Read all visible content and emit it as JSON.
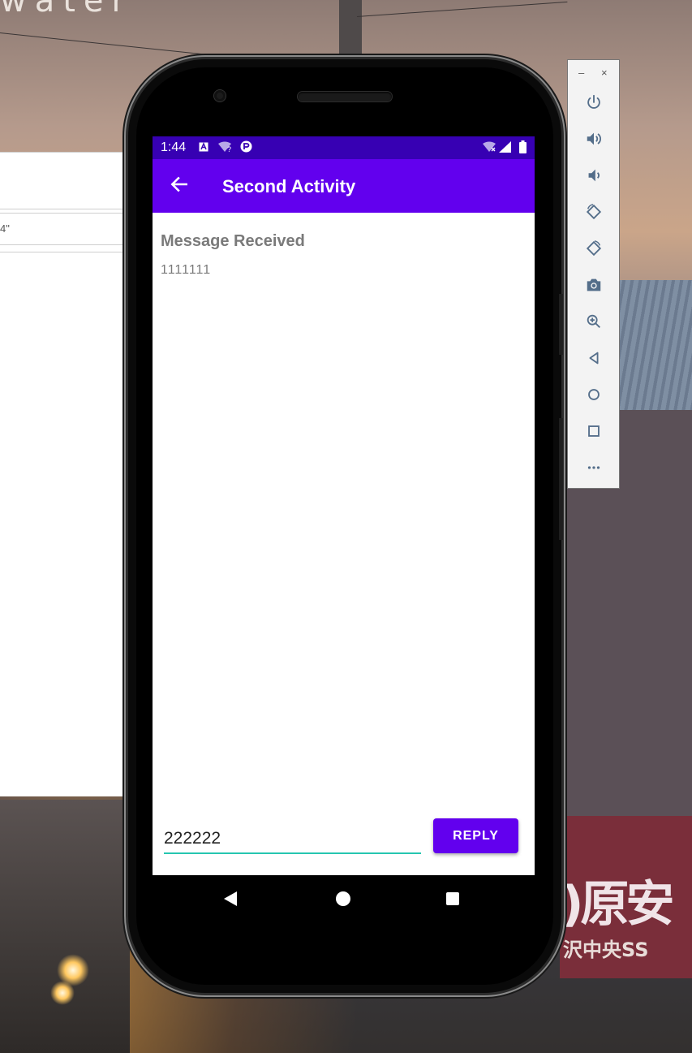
{
  "background": {
    "wall_text": "water",
    "sign_text": ")原安",
    "sign_subtext": "沢中央SS"
  },
  "bg_window": {
    "field_snippet": "4\""
  },
  "status_bar": {
    "time": "1:44",
    "icons": [
      "a-notification-icon",
      "wifi-question-icon",
      "p-circle-icon",
      "wifi-x-icon",
      "signal-icon",
      "battery-icon"
    ]
  },
  "app_bar": {
    "title": "Second Activity",
    "back_icon": "arrow-left-icon"
  },
  "content": {
    "message_label": "Message Received",
    "message_value": "1111111"
  },
  "reply": {
    "input_value": "222222",
    "button_label": "REPLY"
  },
  "nav_bar": {
    "buttons": [
      "back-triangle",
      "home-circle",
      "recents-square"
    ]
  },
  "emulator_toolbar": {
    "minimize": "–",
    "close": "×",
    "buttons": [
      "power-icon",
      "volume-up-icon",
      "volume-down-icon",
      "rotate-left-icon",
      "rotate-right-icon",
      "camera-icon",
      "zoom-icon",
      "back-icon",
      "home-icon",
      "overview-icon",
      "more-icon"
    ]
  },
  "colors": {
    "primary": "#6200ee",
    "primary_dark": "#3700b3",
    "accent": "#26c6b0"
  }
}
